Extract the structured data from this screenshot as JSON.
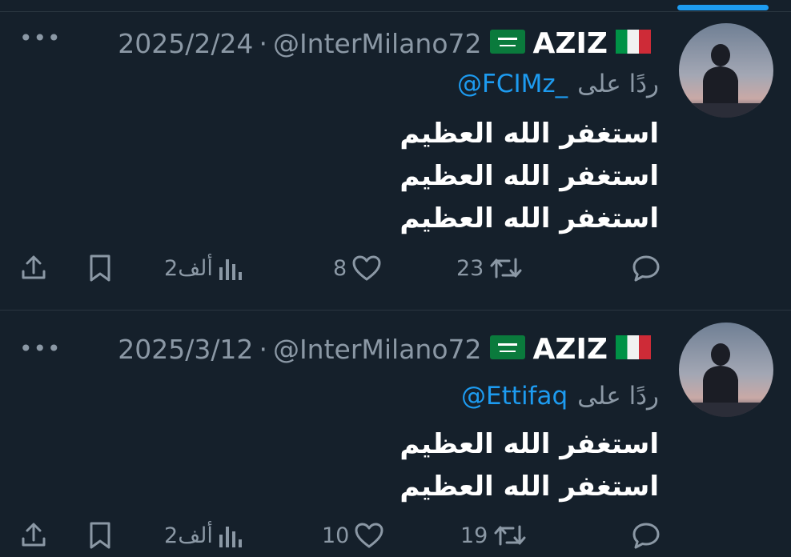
{
  "colors": {
    "background": "#15202b",
    "secondary_text": "#8b98a5",
    "accent": "#1d9bf0"
  },
  "tweets": [
    {
      "name": "AZIZ",
      "handle": "@InterMilano72",
      "date": "2025/2/24",
      "separator": "·",
      "reply_label": "ردًا على",
      "reply_to": "@FCIMz_",
      "lines": [
        "استغفر الله العظيم",
        "استغفر الله العظيم",
        "استغفر الله العظيم"
      ],
      "stats": {
        "retweets": "23",
        "likes": "8",
        "views": "2ألف"
      },
      "icons": {
        "reply": "reply-icon",
        "retweet": "retweet-icon",
        "like": "heart-icon",
        "views": "views-icon",
        "bookmark": "bookmark-icon",
        "share": "share-icon"
      }
    },
    {
      "name": "AZIZ",
      "handle": "@InterMilano72",
      "date": "2025/3/12",
      "separator": "·",
      "reply_label": "ردًا على",
      "reply_to": "@Ettifaq",
      "lines": [
        "استغفر الله العظيم",
        "استغفر الله العظيم"
      ],
      "stats": {
        "retweets": "19",
        "likes": "10",
        "views": "2ألف"
      },
      "icons": {
        "reply": "reply-icon",
        "retweet": "retweet-icon",
        "like": "heart-icon",
        "views": "views-icon",
        "bookmark": "bookmark-icon",
        "share": "share-icon"
      }
    }
  ]
}
